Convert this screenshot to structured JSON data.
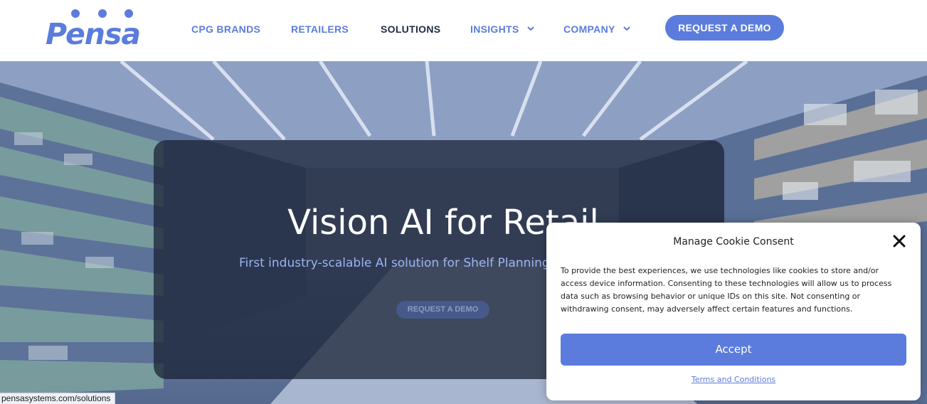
{
  "logo": {
    "text": "Pensa",
    "color": "#5b7cdc"
  },
  "nav": {
    "items": [
      {
        "label": "CPG BRANDS",
        "dropdown": false,
        "active": false
      },
      {
        "label": "RETAILERS",
        "dropdown": false,
        "active": false
      },
      {
        "label": "SOLUTIONS",
        "dropdown": false,
        "active": true
      },
      {
        "label": "INSIGHTS",
        "dropdown": true,
        "active": false
      },
      {
        "label": "COMPANY",
        "dropdown": true,
        "active": false
      }
    ],
    "cta_label": "REQUEST A DEMO"
  },
  "hero": {
    "title": "Vision AI for Retail",
    "subtitle": "First industry-scalable AI solution for Shelf Planning & In",
    "button_label": "REQUEST A DEMO"
  },
  "status_bar": {
    "url": "pensasystems.com/solutions"
  },
  "cookie_consent": {
    "title": "Manage Cookie Consent",
    "close_icon": "close-icon",
    "body": "To provide the best experiences, we use technologies like cookies to store and/or access device information. Consenting to these technologies will allow us to process data such as browsing behavior or unique IDs on this site. Not consenting or withdrawing consent, may adversely affect certain features and functions.",
    "accept_label": "Accept",
    "terms_label": "Terms and Conditions"
  },
  "colors": {
    "brand": "#5b7cdc",
    "nav_active": "#1f2a44",
    "overlay": "#161e30"
  }
}
